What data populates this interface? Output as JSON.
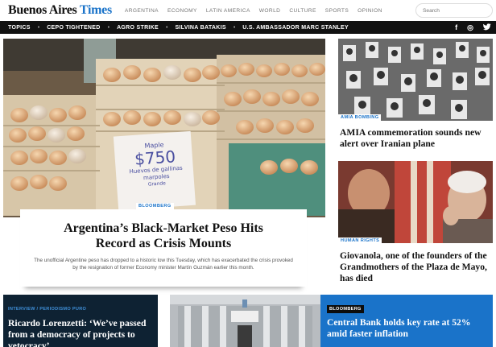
{
  "header": {
    "logo_main": "Buenos Aires",
    "logo_accent": "Times",
    "nav": [
      "ARGENTINA",
      "ECONOMY",
      "LATIN AMERICA",
      "WORLD",
      "CULTURE",
      "SPORTS",
      "OPINION"
    ],
    "search_placeholder": "Search"
  },
  "topicbar": {
    "items": [
      "TOPICS",
      "CEPO TIGHTENED",
      "AGRO STRIKE",
      "SILVINA BATAKIS",
      "U.S. AMBASSADOR MARC STANLEY"
    ],
    "social": {
      "facebook": "f",
      "instagram": "◎",
      "twitter": "🐦"
    }
  },
  "main": {
    "tag": "BLOOMBERG",
    "title": "Argentina’s Black-Market Peso Hits Record as Crisis Mounts",
    "subtitle": "The unofficial Argentine peso has dropped to a historic low this Tuesday, which has exacerbated the crisis provoked by the resignation of former Economy minister Martín Guzmán earlier this month.",
    "sign_top": "Maple",
    "sign_price": "$750",
    "sign_line1": "Huevos de gallinas",
    "sign_line2": "marpoles",
    "sign_line3": "Grande"
  },
  "side": [
    {
      "tag": "AMIA BOMBING",
      "title": "AMIA commemoration sounds new alert over Iranian plane"
    },
    {
      "tag": "HUMAN RIGHTS",
      "title": "Giovanola, one of the founders of the Grandmothers of the Plaza de Mayo, has died"
    }
  ],
  "bottom": {
    "left": {
      "kicker": "INTERVIEW / PERIODISMO PURO",
      "title": "Ricardo Lorenzetti: ‘We’ve passed from a democracy of projects to vetocracy’"
    },
    "right": {
      "kicker": "BLOOMBERG",
      "title": "Central Bank holds key rate at 52% amid faster inflation"
    }
  },
  "colors": {
    "accent": "#1a73c9",
    "dark_bar": "#111111",
    "navy": "#0e2233"
  }
}
